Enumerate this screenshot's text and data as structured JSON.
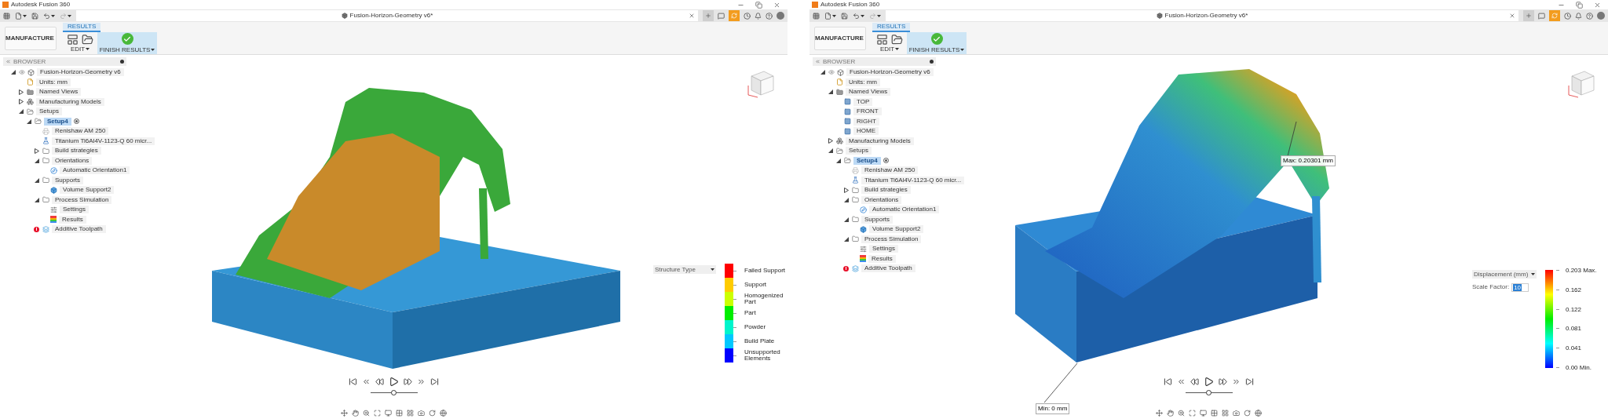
{
  "windows": [
    {
      "app_title": "Autodesk Fusion 360",
      "document_tab": "Fusion-Horizon-Geometry v6*",
      "ribbon": {
        "workspace": "MANUFACTURE",
        "tab": "RESULTS",
        "edit": "EDIT",
        "finish": "FINISH RESULTS"
      },
      "browser": {
        "title": "BROWSER",
        "tree": [
          {
            "label": "Fusion-Horizon-Geometry v6",
            "kind": "component",
            "expanded": true,
            "selected": false,
            "warning": false,
            "children": [
              {
                "label": "Units: mm",
                "kind": "units",
                "selected": false,
                "warning": false
              },
              {
                "label": "Named Views",
                "kind": "views",
                "expanded": false,
                "selected": false,
                "warning": false
              },
              {
                "label": "Manufacturing Models",
                "kind": "models",
                "expanded": false,
                "selected": false,
                "warning": false
              },
              {
                "label": "Setups",
                "kind": "folder-open",
                "expanded": true,
                "selected": false,
                "warning": false,
                "children": [
                  {
                    "label": "Setup4",
                    "kind": "folder-open",
                    "expanded": true,
                    "selected": true,
                    "warning": false,
                    "children": [
                      {
                        "label": "Renishaw AM 250",
                        "kind": "machine",
                        "selected": false,
                        "warning": false
                      },
                      {
                        "label": "Titanium Ti6Al4V-1123-Q 60 micr...",
                        "kind": "material",
                        "selected": false,
                        "warning": false
                      },
                      {
                        "label": "Build strategies",
                        "kind": "folder",
                        "expanded": false,
                        "selected": false,
                        "warning": false
                      },
                      {
                        "label": "Orientations",
                        "kind": "folder",
                        "expanded": true,
                        "selected": false,
                        "warning": false,
                        "children": [
                          {
                            "label": "Automatic Orientation1",
                            "kind": "orientation",
                            "selected": false,
                            "warning": false
                          }
                        ]
                      },
                      {
                        "label": "Supports",
                        "kind": "folder",
                        "expanded": true,
                        "selected": false,
                        "warning": false,
                        "children": [
                          {
                            "label": "Volume Support2",
                            "kind": "support",
                            "selected": false,
                            "warning": false
                          }
                        ]
                      },
                      {
                        "label": "Process Simulation",
                        "kind": "folder",
                        "expanded": true,
                        "selected": false,
                        "warning": false,
                        "children": [
                          {
                            "label": "Settings",
                            "kind": "settings",
                            "selected": false,
                            "warning": false
                          },
                          {
                            "label": "Results",
                            "kind": "results",
                            "selected": false,
                            "warning": false
                          }
                        ]
                      },
                      {
                        "label": "Additive Toolpath",
                        "kind": "toolpath",
                        "selected": false,
                        "warning": true
                      }
                    ]
                  }
                ]
              }
            ]
          }
        ]
      },
      "model": {
        "kind": "structure"
      },
      "legend": {
        "kind": "categories",
        "dropdown": "Structure Type",
        "items": [
          {
            "label": "Failed Support",
            "color": "#ff0000"
          },
          {
            "label": "Support",
            "color": "#ffcc00"
          },
          {
            "label": "Homogenized Part",
            "color": "#ccff00"
          },
          {
            "label": "Part",
            "color": "#00ee00"
          },
          {
            "label": "Powder",
            "color": "#00f5cc"
          },
          {
            "label": "Build Plate",
            "color": "#00c8ff"
          },
          {
            "label": "Unsupported Elements",
            "color": "#0000ff"
          }
        ]
      },
      "timeline": {
        "level": 0.5
      }
    },
    {
      "app_title": "Autodesk Fusion 360",
      "document_tab": "Fusion-Horizon-Geometry v6*",
      "ribbon": {
        "workspace": "MANUFACTURE",
        "tab": "RESULTS",
        "edit": "EDIT",
        "finish": "FINISH RESULTS"
      },
      "browser": {
        "title": "BROWSER",
        "tree": [
          {
            "label": "Fusion-Horizon-Geometry v6",
            "kind": "component",
            "expanded": true,
            "selected": false,
            "warning": false,
            "children": [
              {
                "label": "Units: mm",
                "kind": "units",
                "selected": false,
                "warning": false
              },
              {
                "label": "Named Views",
                "kind": "views",
                "expanded": true,
                "selected": false,
                "warning": false,
                "children": [
                  {
                    "label": "TOP",
                    "kind": "view",
                    "selected": false,
                    "warning": false
                  },
                  {
                    "label": "FRONT",
                    "kind": "view",
                    "selected": false,
                    "warning": false
                  },
                  {
                    "label": "RIGHT",
                    "kind": "view",
                    "selected": false,
                    "warning": false
                  },
                  {
                    "label": "HOME",
                    "kind": "view",
                    "selected": false,
                    "warning": false
                  }
                ]
              },
              {
                "label": "Manufacturing Models",
                "kind": "models",
                "expanded": false,
                "selected": false,
                "warning": false
              },
              {
                "label": "Setups",
                "kind": "folder-open",
                "expanded": true,
                "selected": false,
                "warning": false,
                "children": [
                  {
                    "label": "Setup4",
                    "kind": "folder-open",
                    "expanded": true,
                    "selected": true,
                    "warning": false,
                    "children": [
                      {
                        "label": "Renishaw AM 250",
                        "kind": "machine",
                        "selected": false,
                        "warning": false
                      },
                      {
                        "label": "Titanium Ti6Al4V-1123-Q 60 micr...",
                        "kind": "material",
                        "selected": false,
                        "warning": false
                      },
                      {
                        "label": "Build strategies",
                        "kind": "folder",
                        "expanded": false,
                        "selected": false,
                        "warning": false
                      },
                      {
                        "label": "Orientations",
                        "kind": "folder",
                        "expanded": true,
                        "selected": false,
                        "warning": false,
                        "children": [
                          {
                            "label": "Automatic Orientation1",
                            "kind": "orientation",
                            "selected": false,
                            "warning": false
                          }
                        ]
                      },
                      {
                        "label": "Supports",
                        "kind": "folder",
                        "expanded": true,
                        "selected": false,
                        "warning": false,
                        "children": [
                          {
                            "label": "Volume Support2",
                            "kind": "support",
                            "selected": false,
                            "warning": false
                          }
                        ]
                      },
                      {
                        "label": "Process Simulation",
                        "kind": "folder",
                        "expanded": true,
                        "selected": false,
                        "warning": false,
                        "children": [
                          {
                            "label": "Settings",
                            "kind": "settings",
                            "selected": false,
                            "warning": false
                          },
                          {
                            "label": "Results",
                            "kind": "results",
                            "selected": false,
                            "warning": false
                          }
                        ]
                      },
                      {
                        "label": "Additive Toolpath",
                        "kind": "toolpath",
                        "selected": false,
                        "warning": true
                      }
                    ]
                  }
                ]
              }
            ]
          }
        ]
      },
      "model": {
        "kind": "displacement"
      },
      "legend": {
        "kind": "gradient",
        "dropdown": "Displacement (mm)",
        "scale_factor": {
          "label": "Scale Factor:",
          "value": "10"
        },
        "ticks": [
          "0.203 Max.",
          "0.162",
          "0.122",
          "0.081",
          "0.041",
          "0.00 Min."
        ]
      },
      "annotations": [
        {
          "kind": "max",
          "label": "Max: 0.20301 mm"
        },
        {
          "kind": "min",
          "label": "Min: 0 mm"
        }
      ],
      "timeline": {
        "level": 0.5
      }
    }
  ]
}
